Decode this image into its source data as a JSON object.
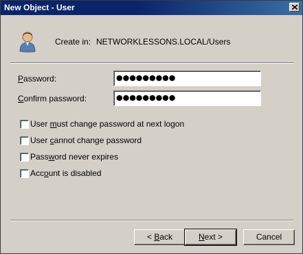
{
  "window": {
    "title": "New Object - User"
  },
  "header": {
    "create_in_label": "Create in:",
    "create_in_path": "NETWORKLESSONS.LOCAL/Users",
    "icon": "user-icon"
  },
  "form": {
    "password_label_accel": "P",
    "password_label_rest": "assword:",
    "password_value": "●●●●●●●●●",
    "confirm_label_accel": "C",
    "confirm_label_rest": "onfirm password:",
    "confirm_value": "●●●●●●●●●"
  },
  "options": [
    {
      "pre": "User ",
      "accel": "m",
      "post": "ust change password at next logon",
      "checked": false
    },
    {
      "pre": "User ",
      "accel": "c",
      "post": "annot change password",
      "checked": false
    },
    {
      "pre": "Pass",
      "accel": "w",
      "post": "ord never expires",
      "checked": false
    },
    {
      "pre": "Acc",
      "accel": "o",
      "post": "unt is disabled",
      "checked": false
    }
  ],
  "buttons": {
    "back_prefix": "< ",
    "back_accel": "B",
    "back_rest": "ack",
    "next_accel": "N",
    "next_rest": "ext >",
    "cancel": "Cancel"
  }
}
